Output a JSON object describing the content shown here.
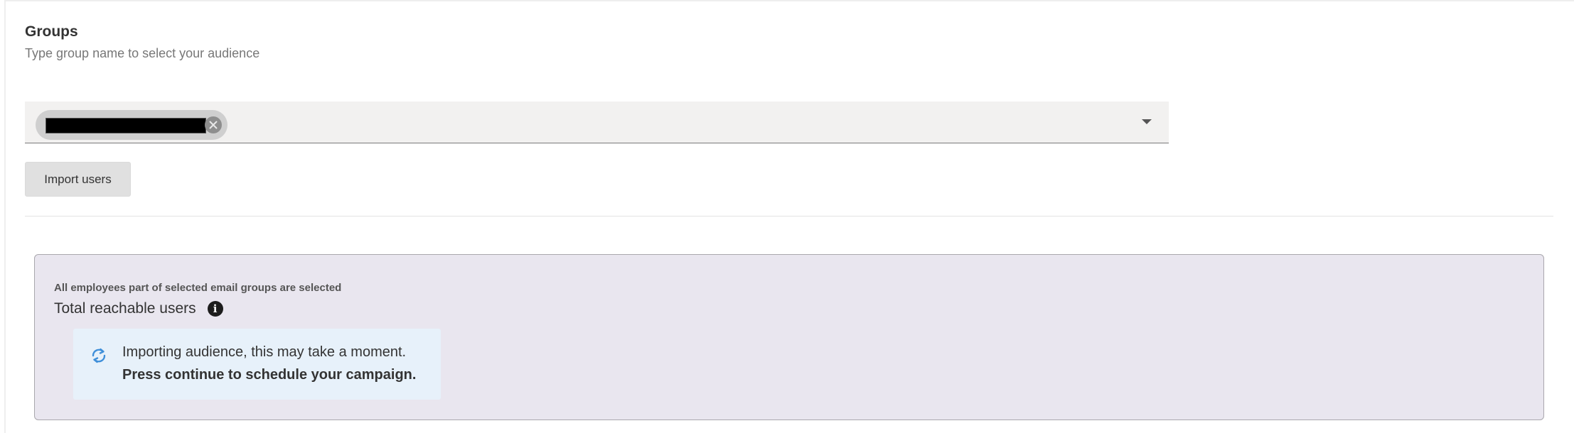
{
  "groups": {
    "title": "Groups",
    "subtitle": "Type group name to select your audience",
    "selected_chip": "████████████████",
    "import_button": "Import users"
  },
  "audience": {
    "note": "All employees part of selected email groups are selected",
    "reach_label": "Total reachable users",
    "info_glyph": "i",
    "status_line1": "Importing audience, this may take a moment.",
    "status_line2": "Press continue to schedule your campaign."
  },
  "colors": {
    "panel_bg": "#e9e6ef",
    "status_bg": "#e7f1fa",
    "sync_icon": "#3f8fd9",
    "select_bg": "#f2f1f0"
  },
  "icons": [
    "clear-chip-icon",
    "chevron-down-icon",
    "info-icon",
    "sync-icon"
  ]
}
